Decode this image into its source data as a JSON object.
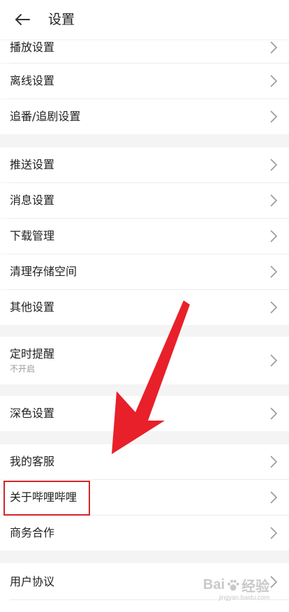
{
  "header": {
    "title": "设置"
  },
  "sections": [
    {
      "items": [
        {
          "label": "播放设置"
        },
        {
          "label": "离线设置"
        },
        {
          "label": "追番/追剧设置"
        }
      ]
    },
    {
      "items": [
        {
          "label": "推送设置"
        },
        {
          "label": "消息设置"
        },
        {
          "label": "下载管理"
        },
        {
          "label": "清理存储空间"
        },
        {
          "label": "其他设置"
        }
      ]
    },
    {
      "items": [
        {
          "label": "定时提醒",
          "sub": "不开启"
        }
      ]
    },
    {
      "items": [
        {
          "label": "深色设置"
        }
      ]
    },
    {
      "items": [
        {
          "label": "我的客服"
        },
        {
          "label": "关于哔哩哔哩"
        },
        {
          "label": "商务合作"
        }
      ]
    },
    {
      "items": [
        {
          "label": "用户协议"
        }
      ]
    }
  ],
  "watermark": {
    "text_a": "Bai",
    "text_b": "经验",
    "sub": "jingyan.baidu.com"
  },
  "colors": {
    "highlight": "#d2262a",
    "arrow": "#e8202a"
  }
}
